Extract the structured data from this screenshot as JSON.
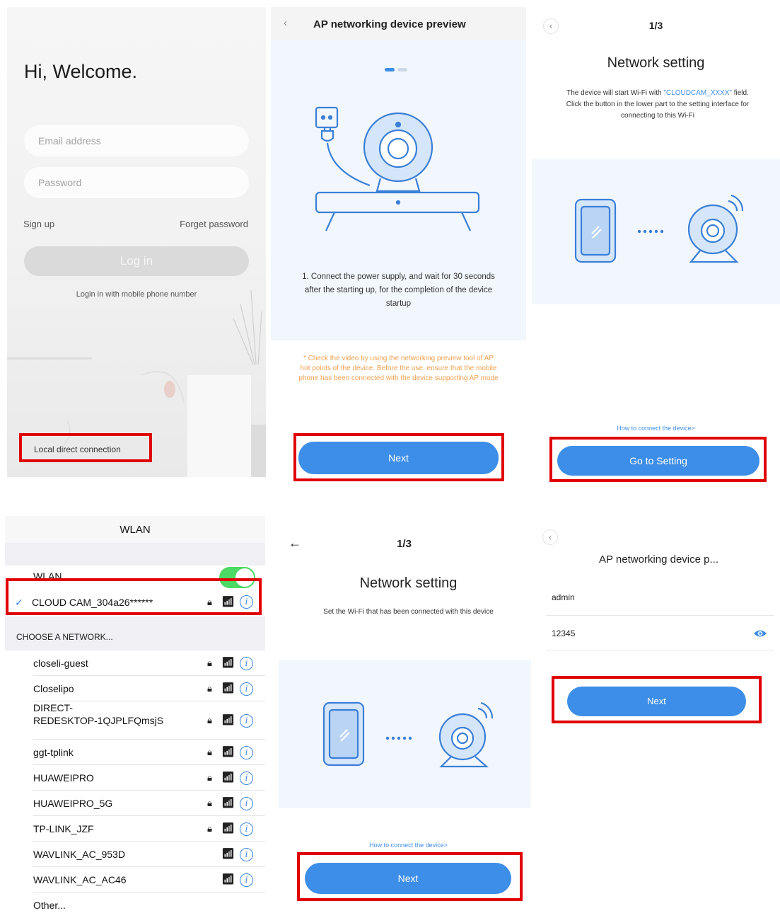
{
  "screen1": {
    "welcome": "Hi, Welcome.",
    "email_placeholder": "Email address",
    "password_placeholder": "Password",
    "sign_up": "Sign up",
    "forget_password": "Forget password",
    "login": "Log in",
    "mobile_login": "Login in with mobile phone number",
    "local_direct": "Local direct connection"
  },
  "screen2": {
    "title": "AP networking device preview",
    "step_text": "1. Connect the power supply, and wait for 30 seconds after the starting up, for the completion of the device startup",
    "notice": "* Check the video by using the networking preview tool of AP hot points of the device. Before the use, ensure that the mobile phone has been connected with the device supporting AP mode",
    "next": "Next"
  },
  "screen3": {
    "step": "1/3",
    "heading": "Network setting",
    "desc_a": "The device will start Wi-Fi with",
    "desc_highlight": "\"CLOUDCAM_XXXX\"",
    "desc_b": "field. Click the button in the lower part to the setting interface for connecting to this Wi-Fi",
    "link": "How to connect the device>",
    "button": "Go to Setting"
  },
  "screen4": {
    "title": "WLAN",
    "wlan_label": "WLAN",
    "connected": "CLOUD CAM_304a26******",
    "choose": "CHOOSE A NETWORK...",
    "networks": [
      {
        "name": "closeli-guest",
        "lock": true
      },
      {
        "name": "Closelipo",
        "lock": true
      },
      {
        "name": "DIRECT-",
        "name2": "REDESKTOP-1QJPLFQmsjS",
        "lock": true
      },
      {
        "name": "ggt-tplink",
        "lock": true
      },
      {
        "name": "HUAWEIPRO",
        "lock": true
      },
      {
        "name": "HUAWEIPRO_5G",
        "lock": true
      },
      {
        "name": "TP-LINK_JZF",
        "lock": true
      },
      {
        "name": "WAVLINK_AC_953D",
        "lock": false
      },
      {
        "name": "WAVLINK_AC_AC46",
        "lock": false
      }
    ],
    "other": "Other..."
  },
  "screen5": {
    "step": "1/3",
    "heading": "Network setting",
    "desc": "Set the Wi-Fi that has been connected with this device",
    "link": "How to connect the device>",
    "next": "Next"
  },
  "screen6": {
    "title": "AP networking device p...",
    "username": "admin",
    "password": "12345",
    "next": "Next"
  },
  "colors": {
    "accent": "#3d8ee8",
    "highlight": "#e00000",
    "notice": "#f0a050",
    "toggle": "#4cd964"
  }
}
